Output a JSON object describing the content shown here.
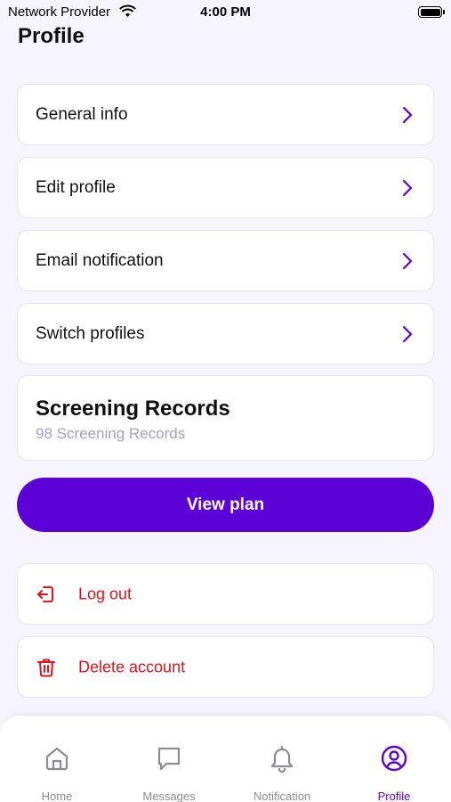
{
  "status_bar": {
    "carrier": "Network Provider",
    "time": "4:00 PM"
  },
  "page": {
    "title": "Profile"
  },
  "menu_items": [
    {
      "label": "General info"
    },
    {
      "label": "Edit profile"
    },
    {
      "label": "Email notification"
    },
    {
      "label": "Switch profiles"
    }
  ],
  "records": {
    "title": "Screening Records",
    "subtitle": "98 Screening Records"
  },
  "plan_button": {
    "label": "View plan"
  },
  "actions": {
    "logout": {
      "label": "Log out",
      "icon": "logout-icon"
    },
    "delete": {
      "label": "Delete account",
      "icon": "trash-icon"
    }
  },
  "tabs": [
    {
      "label": "Home",
      "icon": "home-icon"
    },
    {
      "label": "Messages",
      "icon": "message-icon"
    },
    {
      "label": "Notification",
      "icon": "bell-icon"
    },
    {
      "label": "Profile",
      "icon": "user-circle-icon",
      "active": true
    }
  ],
  "colors": {
    "accent": "#5d02d6",
    "danger": "#e0131b",
    "background": "#f6f4fd",
    "subtitle": "#a59fc9"
  }
}
